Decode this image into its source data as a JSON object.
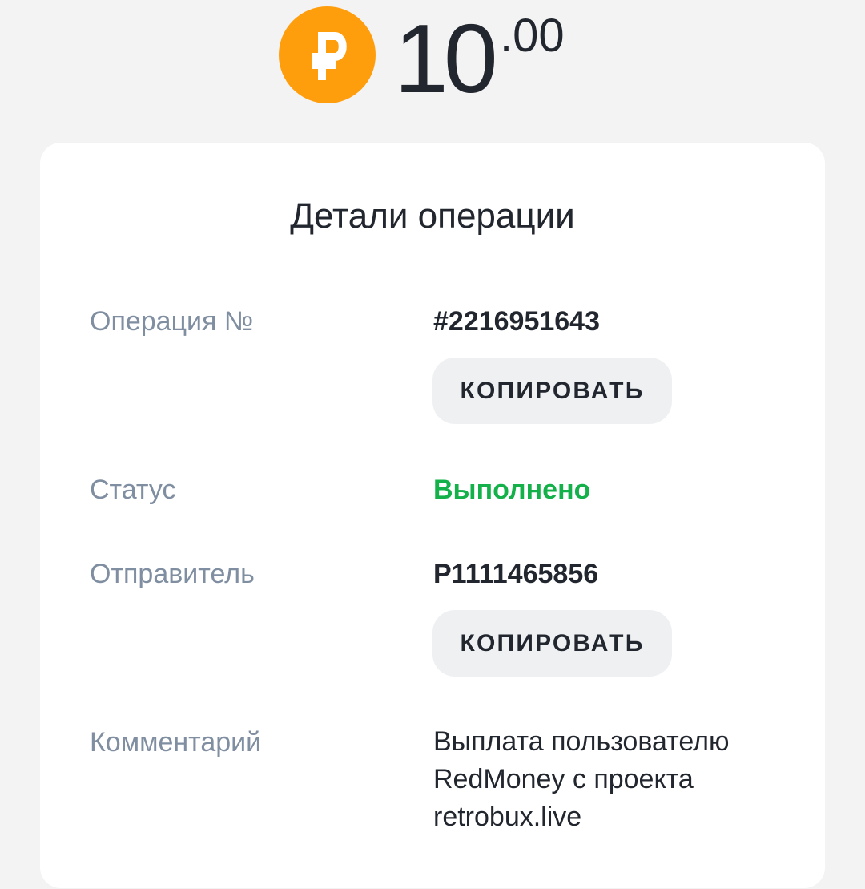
{
  "amount": {
    "currency_icon": "ruble-coin-icon",
    "coin_color": "#ff9e0d",
    "integer": "10",
    "fraction": ".00"
  },
  "details": {
    "title": "Детали операции",
    "operation": {
      "label": "Операция №",
      "value": "#2216951643",
      "copy_label": "КОПИРОВАТЬ"
    },
    "status": {
      "label": "Статус",
      "value": "Выполнено",
      "color": "#14b04a"
    },
    "sender": {
      "label": "Отправитель",
      "value": "P1111465856",
      "copy_label": "КОПИРОВАТЬ"
    },
    "comment": {
      "label": "Комментарий",
      "value": "Выплата пользователю RedMoney с проекта retrobux.live"
    }
  }
}
